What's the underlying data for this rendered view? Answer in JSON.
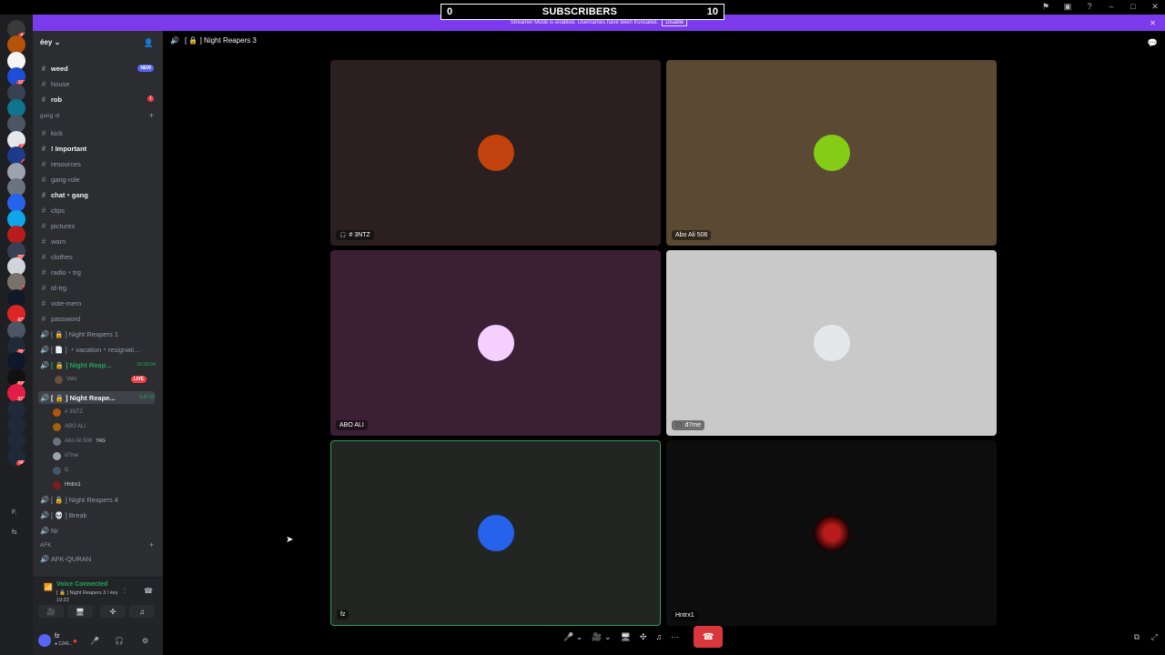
{
  "overlay": {
    "left_count": "0",
    "label": "SUBSCRIBERS",
    "right_count": "10"
  },
  "banner": {
    "text": "Streamer Mode is enabled. Usernames have been truncated.",
    "disable": "Disable"
  },
  "rail": {
    "badges": [
      "41",
      "",
      "",
      "167",
      "",
      "",
      "",
      "16",
      "7",
      "",
      "",
      "",
      "",
      "",
      "268",
      "",
      "2",
      "",
      "973",
      "",
      "764",
      "",
      "699",
      "371",
      "",
      "",
      "",
      "NEW"
    ],
    "folder_label_1": "F.",
    "folder_label_2": "fs"
  },
  "server": {
    "name": "éey"
  },
  "channels": [
    {
      "name": "weed",
      "bold": true,
      "badge": "NEW"
    },
    {
      "name": "house",
      "bold": false
    },
    {
      "name": "rob",
      "bold": true,
      "count": "1"
    }
  ],
  "category_gang": "gang ol",
  "gang_channels": [
    {
      "name": "kick"
    },
    {
      "name": "! Important",
      "bold": true,
      "emoji": "🔴"
    },
    {
      "name": "resources",
      "emoji": "♻"
    },
    {
      "name": "gang-role",
      "prefix": "[",
      "emoji": "💀",
      "suffix": "]"
    },
    {
      "name": "chat・gang",
      "prefix": "[",
      "emoji": "📜",
      "suffix": "]",
      "bold": true
    },
    {
      "name": "clips",
      "prefix": "[",
      "emoji": "📼",
      "suffix": "]"
    },
    {
      "name": "pictures",
      "prefix": "[",
      "emoji": "🖼",
      "suffix": "]"
    },
    {
      "name": "warn",
      "prefix": "[",
      "emoji": "⛔",
      "suffix": "]"
    },
    {
      "name": "clothes",
      "prefix": "[",
      "emoji": "🧥",
      "suffix": "]"
    },
    {
      "name": "radio・trg",
      "prefix": "[",
      "emoji": "📞",
      "suffix": "]"
    },
    {
      "name": "id-trg"
    },
    {
      "name": "vote-mem"
    },
    {
      "name": "password"
    },
    {
      "name": "[ 🔒 ] Night Reapers 1"
    },
    {
      "name": "[ 📄 ] ・vacation・resignati..."
    }
  ],
  "voice_active_1": {
    "name": "[ 🔒 ] Night Reap...",
    "time": "18:58:04"
  },
  "voice_active_1_users": [
    {
      "name": "Velx",
      "live": "LIVE"
    }
  ],
  "voice_active_2": {
    "name": "[ 🔒 ] Night Reape...",
    "time": "3:47:07"
  },
  "voice_active_2_users": [
    {
      "name": "# 3NTZ"
    },
    {
      "name": "ABO ALI"
    },
    {
      "name": "Abo Ali 506",
      "tag": "TRG"
    },
    {
      "name": "d7me"
    },
    {
      "name": "fz"
    },
    {
      "name": "Hntrx1"
    }
  ],
  "voice_more": [
    {
      "name": "[ 🔒 ] Night Reapers 4"
    },
    {
      "name": "[ 💀 ] Break"
    },
    {
      "name": "Nr"
    }
  ],
  "category_afk": "AFK",
  "afk_channel": "AFK-QURAN",
  "voice_panel": {
    "status": "Voice Connected",
    "sub": "[ 🔒 ] Night Reapers 3 / éey",
    "time": "19:22"
  },
  "user": {
    "name": "fz",
    "sub": "● 1249..."
  },
  "header": {
    "channel": "[ 🔒 ] Night Reapers 3"
  },
  "tiles": [
    {
      "name": "# 3NTZ",
      "bg": "#2b1f1f",
      "icon": true
    },
    {
      "name": "Abo Ali 506",
      "bg": "#5a4a33",
      "icon": false
    },
    {
      "name": "ABO ALI",
      "bg": "#3b1f35",
      "icon": false
    },
    {
      "name": "d7me",
      "bg": "#c9c9c9",
      "icon": true
    },
    {
      "name": "fz",
      "bg": "#222522",
      "icon": false,
      "speaking": true
    },
    {
      "name": "Hntrx1",
      "bg": "#0d0d0d",
      "icon": false
    }
  ],
  "colors": {
    "accent": "#7c3aed",
    "hangup": "#da373c",
    "speaking": "#23a55a",
    "voice_connected": "#23a55a"
  }
}
